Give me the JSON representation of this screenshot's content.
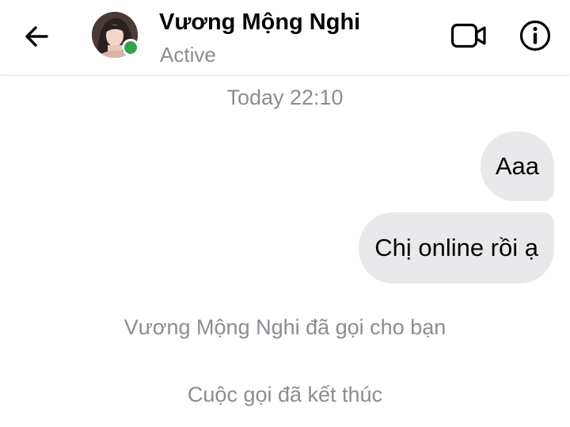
{
  "header": {
    "contact_name": "Vương Mộng Nghi",
    "status": "Active",
    "icons": {
      "back": "arrow-left-icon",
      "video": "video-camera-icon",
      "info": "info-circle-icon"
    },
    "presence_color": "#31a24c"
  },
  "conversation": {
    "timestamp": "Today 22:10",
    "messages": [
      {
        "text": "Aaa",
        "direction": "sent"
      },
      {
        "text": "Chị online rồi ạ",
        "direction": "sent"
      }
    ],
    "system_events": [
      {
        "text": "Vương Mộng Nghi đã gọi cho bạn"
      },
      {
        "text": "Cuộc gọi đã kết thúc"
      }
    ]
  },
  "colors": {
    "bubble": "#e9e9eb",
    "muted_text": "#8a8d91",
    "primary_text": "#050505"
  }
}
